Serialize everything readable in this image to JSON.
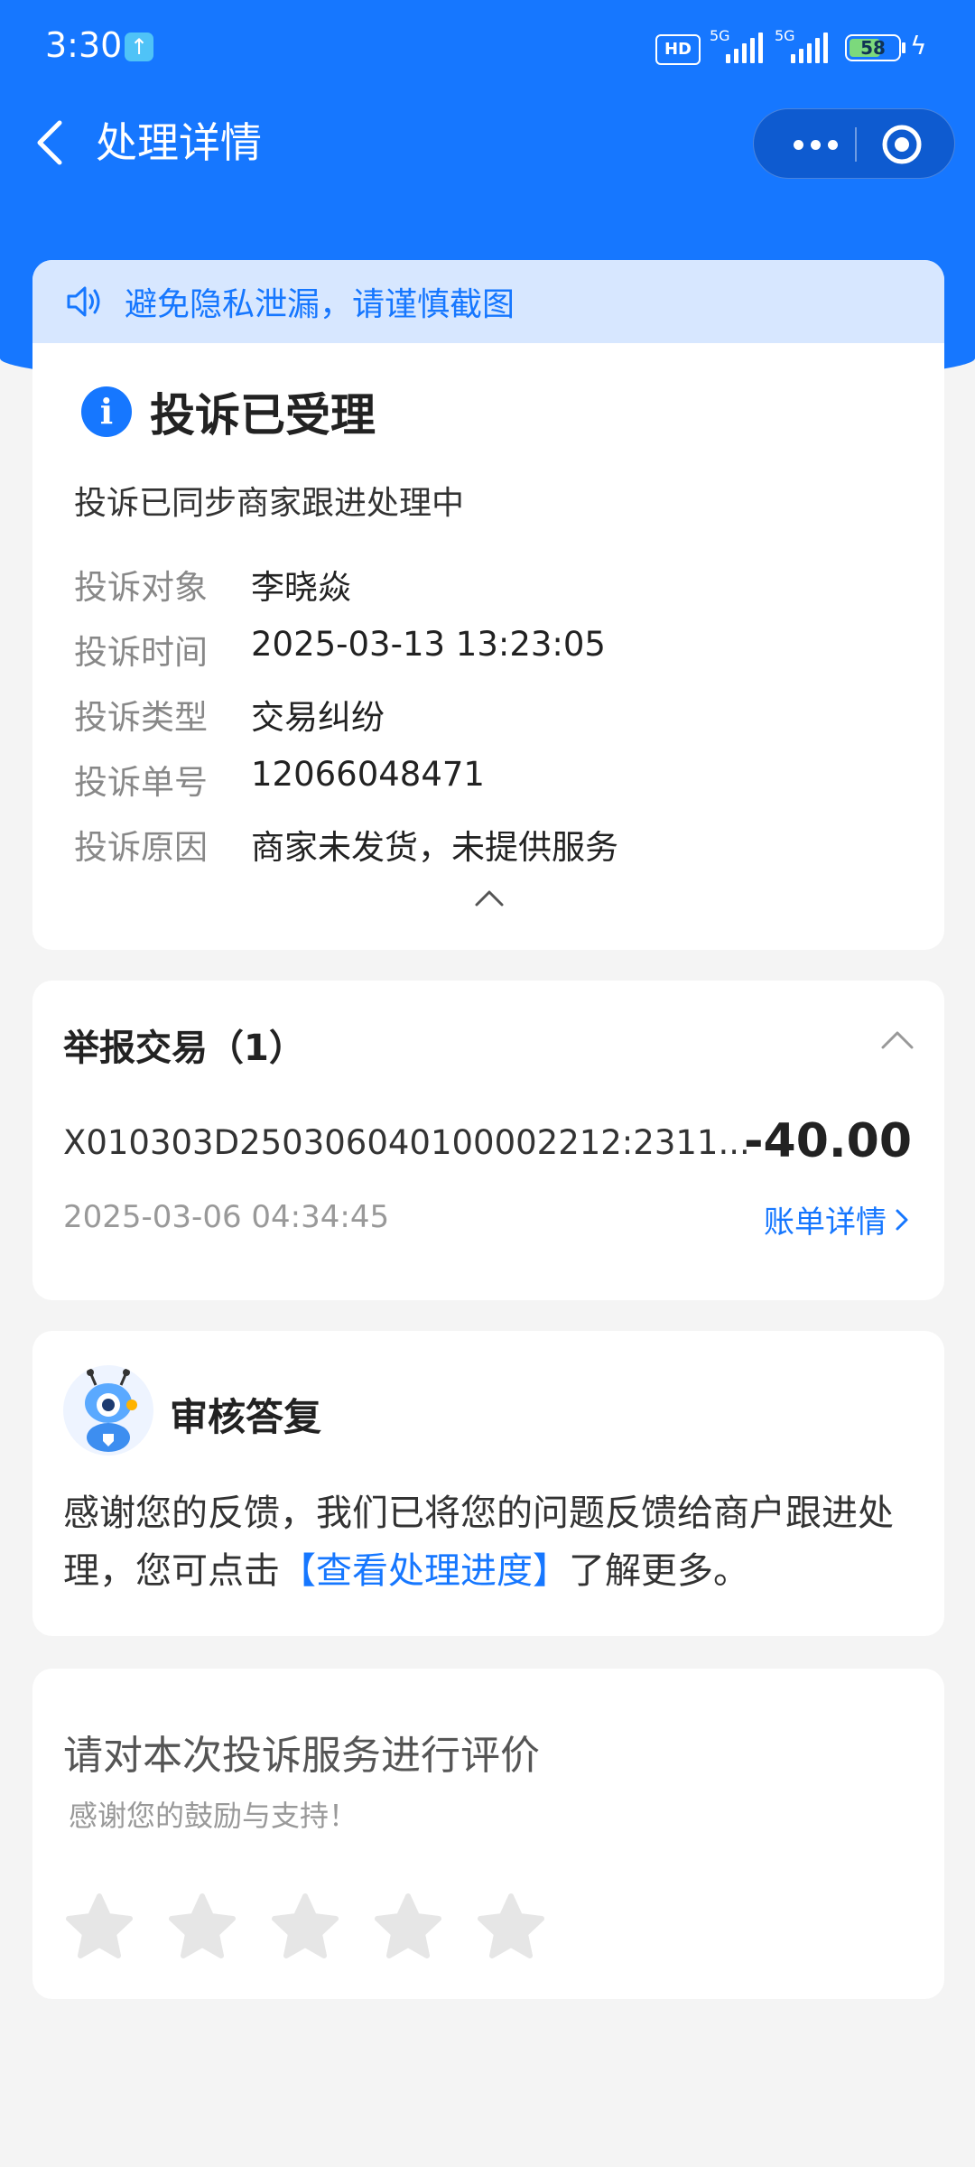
{
  "status_bar": {
    "time": "3:30",
    "hd_label": "HD",
    "network_1": "5G",
    "network_2": "5G",
    "battery": "58"
  },
  "nav": {
    "title": "处理详情",
    "back_icon": "chevron-left-icon",
    "more_icon": "more-dots-icon",
    "target_icon": "target-icon"
  },
  "notice": {
    "text": "避免隐私泄漏，请谨慎截图",
    "icon": "speaker-icon"
  },
  "complaint": {
    "status_title": "投诉已受理",
    "status_sub": "投诉已同步商家跟进处理中",
    "details": [
      {
        "label": "投诉对象",
        "value": "李晓焱"
      },
      {
        "label": "投诉时间",
        "value": "2025-03-13 13:23:05"
      },
      {
        "label": "投诉类型",
        "value": "交易纠纷"
      },
      {
        "label": "投诉单号",
        "value": "12066048471"
      },
      {
        "label": "投诉原因",
        "value": "商家未发货，未提供服务"
      }
    ]
  },
  "report": {
    "title": "举报交易（1）",
    "transaction": {
      "id": "X010303D250306040100002212:2311...",
      "amount": "-40.00",
      "time": "2025-03-06 04:34:45",
      "link": "账单详情"
    }
  },
  "reply": {
    "title": "审核答复",
    "text_before": "感谢您的反馈，我们已将您的问题反馈给商户跟进处理，您可点击",
    "link": "【查看处理进度】",
    "text_after": "了解更多。"
  },
  "rating": {
    "title": "请对本次投诉服务进行评价",
    "subtitle": "感谢您的鼓励与支持！",
    "stars": 0,
    "max_stars": 5
  },
  "colors": {
    "accent": "#1677ff",
    "background": "#f4f4f4",
    "notice_bg": "#d7e7ff",
    "star_empty": "#e6e6e6"
  }
}
